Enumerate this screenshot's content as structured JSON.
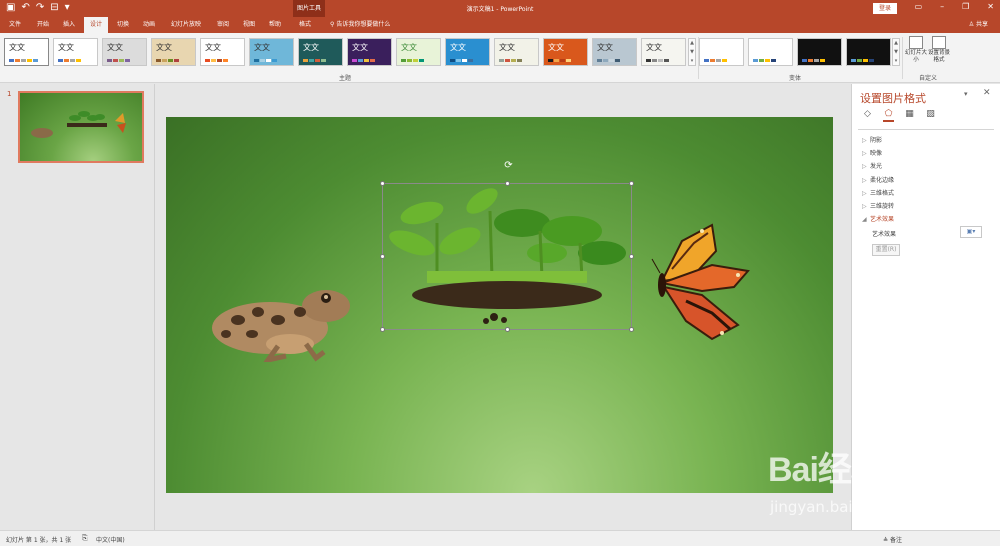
{
  "titlebar": {
    "tool_context": "图片工具",
    "doc_title": "演示文稿1  -  PowerPoint",
    "login_label": "登录",
    "accent": "#b7472a"
  },
  "tabs": {
    "file": "文件",
    "home": "开始",
    "insert": "插入",
    "design": "设计",
    "transitions": "切换",
    "animations": "动画",
    "slideshow": "幻灯片放映",
    "review": "审阅",
    "view": "视图",
    "help": "帮助",
    "format": "格式",
    "tell_me": "告诉我你想要做什么",
    "share": "共享"
  },
  "ribbon": {
    "theme_thumb_label": "文文",
    "group_themes": "主题",
    "group_variants": "变体",
    "group_customize": "自定义",
    "slide_size": "幻灯片大小",
    "format_background": "设置背景格式"
  },
  "left_pane": {
    "slide_number": "1"
  },
  "format_pane": {
    "title": "设置图片格式",
    "sections": [
      "阴影",
      "映像",
      "发光",
      "柔化边缘",
      "三维格式",
      "三维旋转",
      "艺术效果"
    ],
    "art_effects_label": "艺术效果",
    "reset_label": "重置(R)"
  },
  "statusbar": {
    "slide_info": "幻灯片 第 1 张，共 1 张",
    "language": "中文(中国)",
    "notes": "备注"
  },
  "watermark": {
    "brand": "Bai经验",
    "url": "jingyan.baidu.com"
  }
}
